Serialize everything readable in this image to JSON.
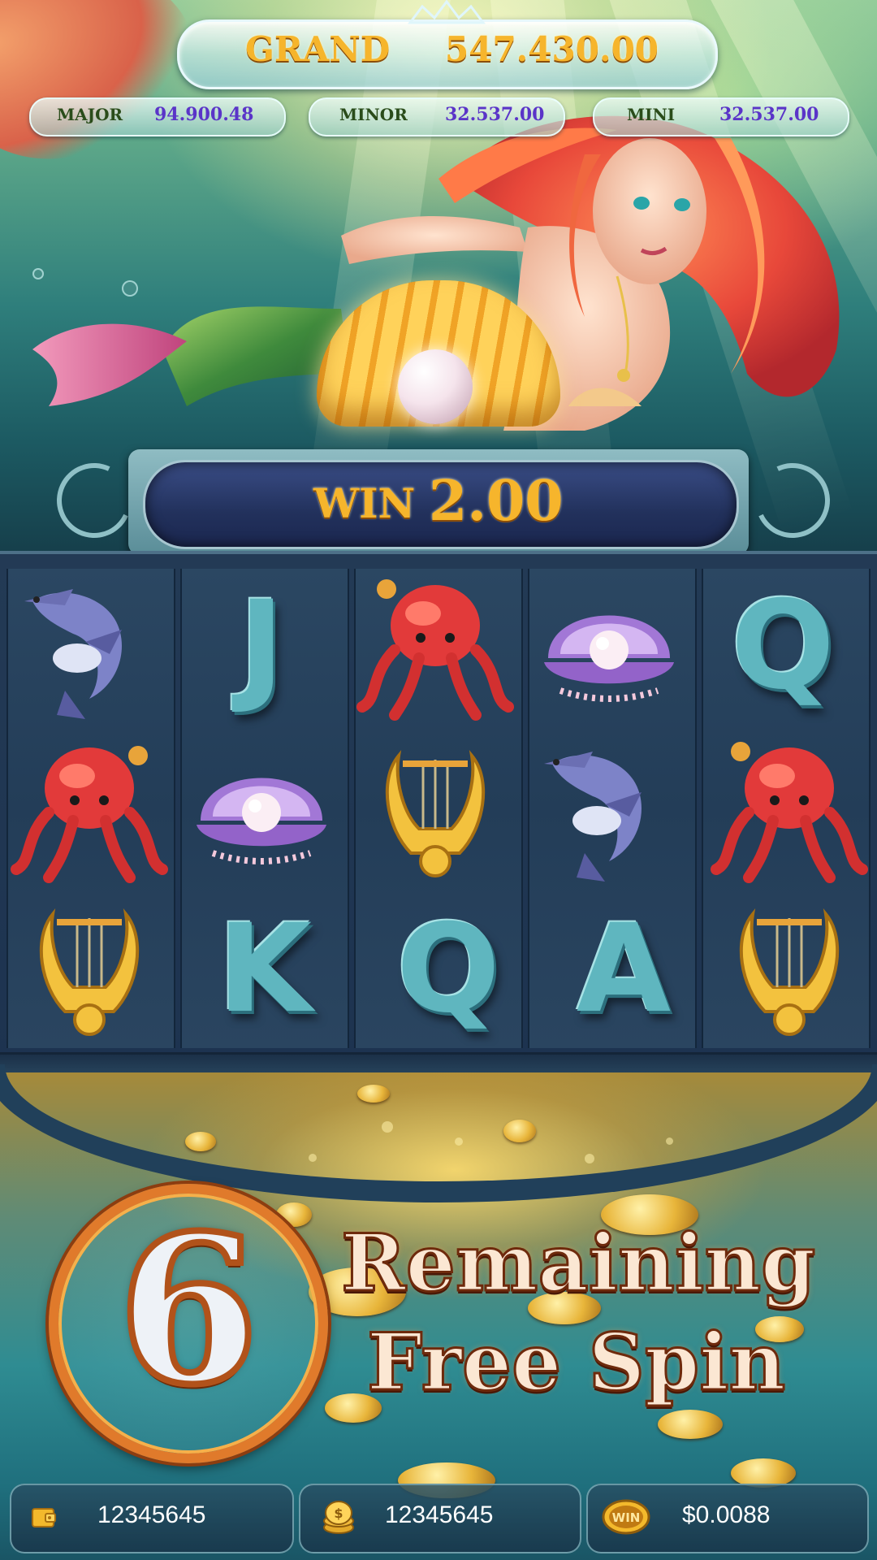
{
  "jackpots": {
    "grand": {
      "label": "GRAND",
      "value": "547.430.00"
    },
    "major": {
      "label": "MAJOR",
      "value": "94.900.48"
    },
    "minor": {
      "label": "MINOR",
      "value": "32.537.00"
    },
    "mini": {
      "label": "MINI",
      "value": "32.537.00"
    }
  },
  "win_banner": {
    "label": "WIN",
    "value": "2.00"
  },
  "reels": {
    "columns": [
      [
        "hammerhead-shark",
        "red-octopus",
        "golden-lyre"
      ],
      [
        "J",
        "pearl-clam",
        "K"
      ],
      [
        "red-octopus",
        "golden-lyre",
        "Q"
      ],
      [
        "pearl-clam",
        "hammerhead-shark",
        "A"
      ],
      [
        "Q",
        "red-octopus",
        "golden-lyre"
      ]
    ]
  },
  "free_spin": {
    "count": "6",
    "line1": "Remaining",
    "line2": "Free Spin"
  },
  "status_bar": {
    "balance": {
      "icon": "wallet-icon",
      "value": "12345645"
    },
    "bet": {
      "icon": "coin-stack-icon",
      "value": "12345645"
    },
    "win": {
      "icon": "win-badge-icon",
      "badge_text": "WIN",
      "value": "$0.0088"
    }
  }
}
